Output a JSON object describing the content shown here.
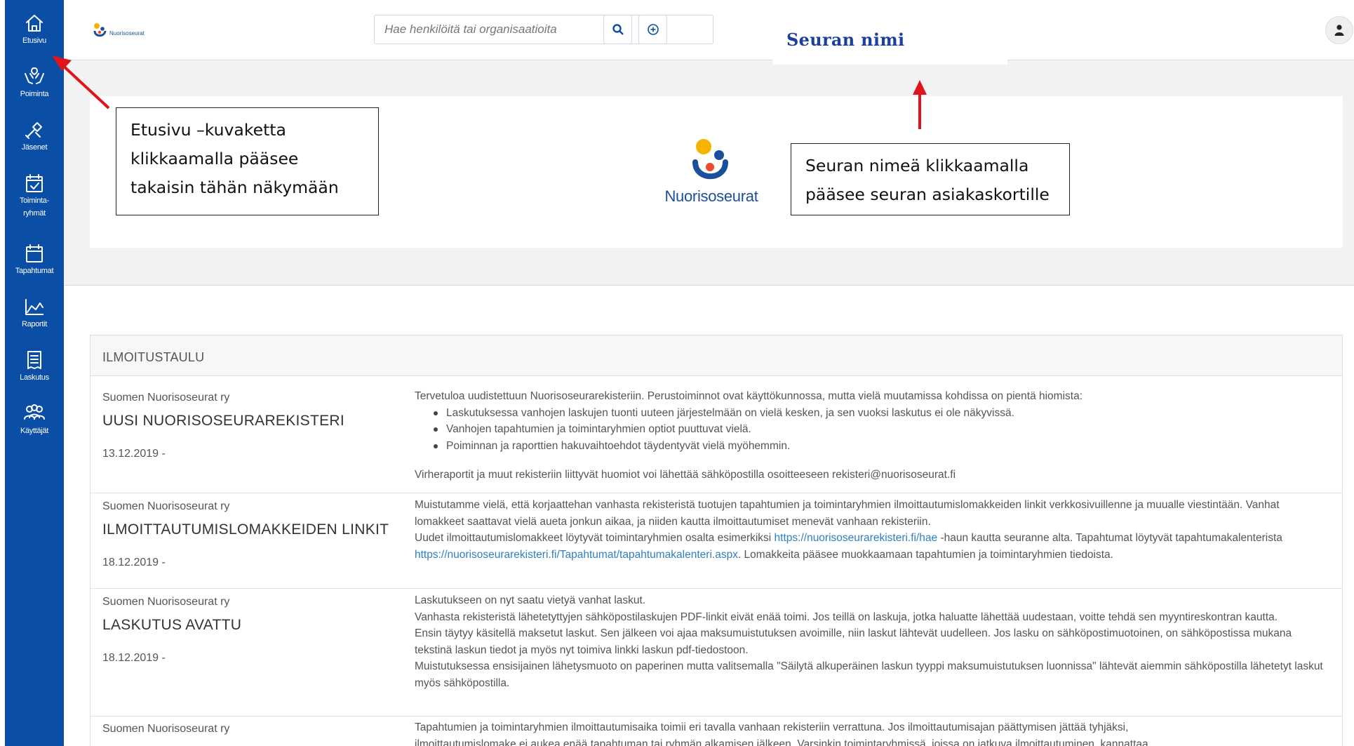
{
  "sidebar": {
    "items": [
      {
        "label": "Etusivu",
        "icon": "home-icon"
      },
      {
        "label": "Poiminta",
        "icon": "hands-icon"
      },
      {
        "label": "Jäsenet",
        "icon": "tools-icon"
      },
      {
        "label": "Toiminta-",
        "label2": "ryhmät",
        "icon": "calendar-check-icon"
      },
      {
        "label": "Tapahtumat",
        "icon": "calendar-icon"
      },
      {
        "label": "Raportit",
        "icon": "chart-area-icon"
      },
      {
        "label": "Laskutus",
        "icon": "invoice-icon"
      },
      {
        "label": "Käyttäjät",
        "icon": "users-icon"
      }
    ]
  },
  "header": {
    "logo_text": "Nuorisoseurat",
    "search_placeholder": "Hae henkilöitä tai organisaatioita",
    "org_name": "Seuran nimi"
  },
  "banner": {
    "logo_text": "Nuorisoseurat"
  },
  "callouts": {
    "home": {
      "line1": "Etusivu –kuvaketta",
      "line2": "klikkaamalla pääsee",
      "line3": "takaisin tähän näkymään"
    },
    "org": {
      "line1": "Seuran nimeä klikkaamalla",
      "line2": "pääsee seuran asiakaskortille"
    }
  },
  "board": {
    "title": "ILMOITUSTAULU",
    "rows": [
      {
        "org": "Suomen Nuorisoseurat ry",
        "title": "UUSI NUORISOSEURAREKISTERI",
        "date": "13.12.2019 -",
        "intro": "Tervetuloa uudistettuun Nuorisoseurarekisteriin. Perustoiminnot ovat käyttökunnossa, mutta vielä muutamissa kohdissa on pientä hiomista:",
        "bullets": [
          "Laskutuksessa vanhojen laskujen tuonti uuteen järjestelmään on vielä kesken, ja sen vuoksi laskutus ei ole näkyvissä.",
          "Vanhojen tapahtumien ja toimintaryhmien optiot puuttuvat vielä.",
          "Poiminnan ja raporttien hakuvaihtoehdot täydentyvät vielä myöhemmin."
        ],
        "outro": "Virheraportit ja muut rekisteriin liittyvät huomiot voi lähettää sähköpostilla osoitteeseen rekisteri@nuorisoseurat.fi"
      },
      {
        "org": "Suomen Nuorisoseurat ry",
        "title": "ILMOITTAUTUMISLOMAKKEIDEN LINKIT",
        "date": "18.12.2019 -",
        "p1": "Muistutamme vielä, että korjaattehan vanhasta rekisteristä tuotujen tapahtumien ja toimintaryhmien ilmoittautumislomakkeiden linkit verkkosivuillenne ja muualle viestintään. Vanhat lomakkeet saattavat vielä aueta jonkun aikaa, ja niiden kautta ilmoittautumiset menevät vanhaan rekisteriin.",
        "p2a": "Uudet ilmoittautumislomakkeet löytyvät toimintaryhmien osalta esimerkiksi ",
        "link1": "https://nuorisoseurarekisteri.fi/hae",
        "p2b": " -haun kautta seuranne alta. Tapahtumat löytyvät tapahtumakalenterista ",
        "link2": "https://nuorisoseurarekisteri.fi/Tapahtumat/tapahtumakalenteri.aspx",
        "p2c": ". Lomakkeita pääsee muokkaamaan tapahtumien ja toimintaryhmien tiedoista."
      },
      {
        "org": "Suomen Nuorisoseurat ry",
        "title": "LASKUTUS AVATTU",
        "date": "18.12.2019 -",
        "lines": [
          "Laskutukseen on nyt saatu vietyä vanhat laskut.",
          "Vanhasta rekisteristä lähetetyttyjen sähköpostilaskujen PDF-linkit eivät enää toimi. Jos teillä on laskuja, jotka haluatte lähettää uudestaan, voitte tehdä sen myyntireskontran kautta.",
          "Ensin täytyy käsitellä maksetut laskut. Sen jälkeen voi ajaa maksumuistutuksen avoimille, niin laskut lähtevät uudelleen. Jos lasku on sähköpostimuotoinen, on sähköpostissa mukana tekstinä laskun tiedot ja myös nyt toimiva linkki laskun pdf-tiedostoon.",
          "Muistutuksessa ensisijainen lähetysmuoto on paperinen mutta valitsemalla \"Säilytä alkuperäinen laskun tyyppi maksumuistutuksen luonnissa\" lähtevät aiemmin sähköpostilla lähetetyt laskut myös sähköpostilla."
        ]
      },
      {
        "org": "Suomen Nuorisoseurat ry",
        "line1": "Tapahtumien ja toimintaryhmien ilmoittautumisaika toimii eri tavalla vanhaan rekisteriin verrattuna. Jos ilmoittautumisajan päättymisen jättää tyhjäksi,",
        "line2": "ilmoittautumislomake ei aukea enää tapahtuman tai ryhmän alkamisen jälkeen. Varsinkin toimintaryhmissä, joissa on jatkuva ilmoittautuminen, kannattaa"
      }
    ]
  },
  "colors": {
    "sidebar": "#0a4ea6",
    "accent": "#1a3f9d",
    "arrow": "#e0141b",
    "link": "#2e7fc2"
  }
}
